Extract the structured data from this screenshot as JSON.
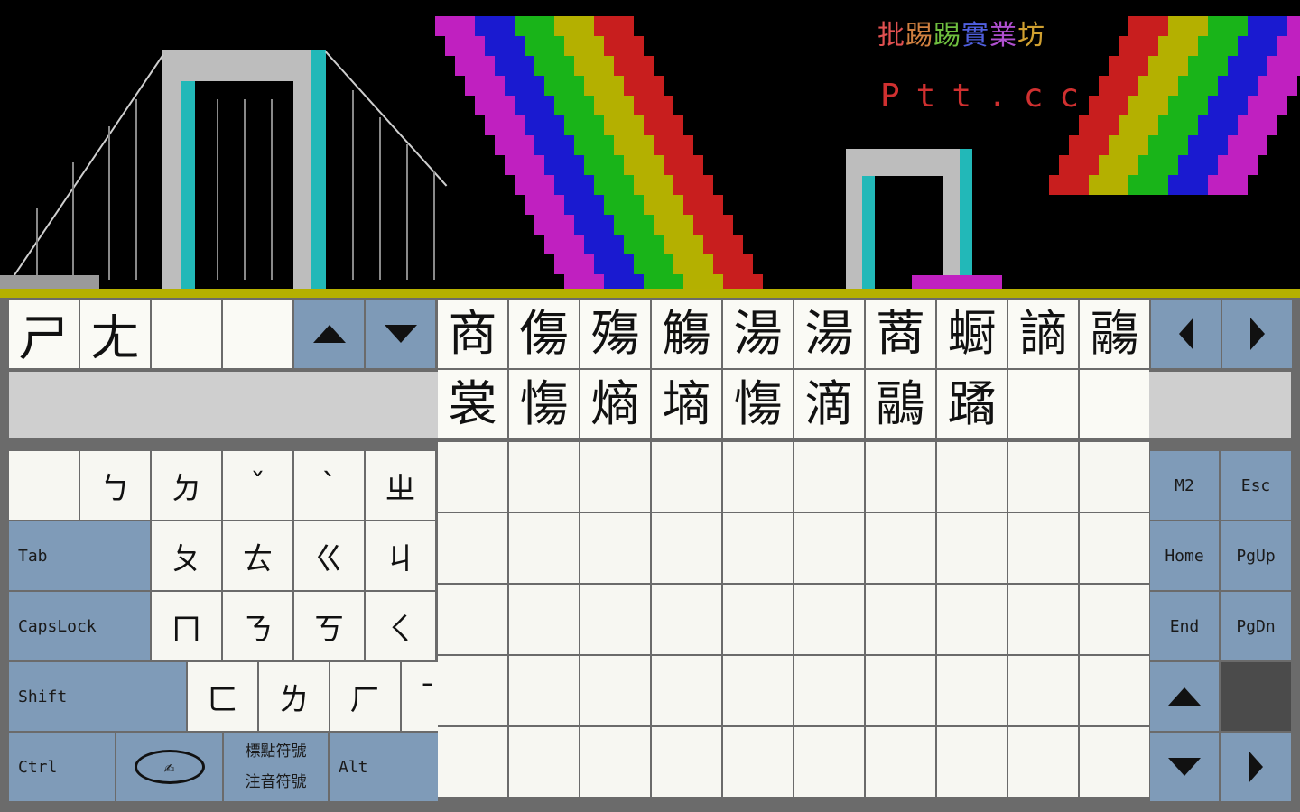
{
  "terminal": {
    "title_chars": [
      "批",
      "踢",
      "踢",
      "實",
      "業",
      "坊"
    ],
    "site": "Ptt.cc",
    "colors": {
      "rainbow": [
        "#c81e1e",
        "#b4b000",
        "#19b419",
        "#1a1ad0",
        "#c020c0"
      ]
    }
  },
  "composition": {
    "zhuyin": [
      "ㄕ",
      "ㄤ",
      "",
      ""
    ],
    "up_icon": "triangle-up-icon",
    "down_icon": "triangle-down-icon"
  },
  "candidates": {
    "row1": [
      "商",
      "傷",
      "殤",
      "觴",
      "湯",
      "湯",
      "蔏",
      "蟵",
      "謪",
      "鬺"
    ],
    "row2": [
      "裳",
      "慯",
      "熵",
      "墒",
      "慯",
      "滴",
      "鷊",
      "蹫",
      "",
      ""
    ],
    "prev_icon": "triangle-left-icon",
    "next_icon": "triangle-right-icon"
  },
  "keyboard": {
    "row1": [
      "",
      "ㄅ",
      "ㄉ",
      "ˇ",
      "ˋ",
      "ㄓ"
    ],
    "row2_label": "Tab",
    "row2": [
      "ㄆ",
      "ㄊ",
      "ㄍ",
      "ㄐ"
    ],
    "row3_label": "CapsLock",
    "row3": [
      "ㄇ",
      "ㄋ",
      "ㄎ",
      "ㄑ"
    ],
    "row4_label": "Shift",
    "row4": [
      "ㄈ",
      "ㄌ",
      "ㄏ",
      "ˉ"
    ],
    "ctrl": "Ctrl",
    "symbol_top": "標點符號",
    "symbol_bottom": "注音符號",
    "alt": "Alt",
    "m2": "M2",
    "esc": "Esc",
    "home": "Home",
    "pgup": "PgUp",
    "end": "End",
    "pgdn": "PgDn"
  }
}
